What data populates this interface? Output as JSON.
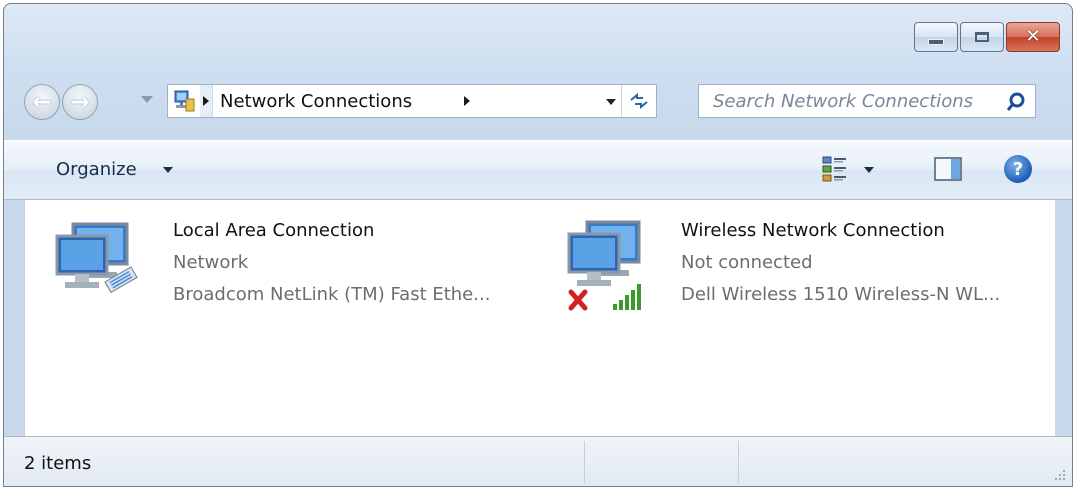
{
  "nav": {
    "address_path": "Network Connections",
    "search_placeholder": "Search Network Connections"
  },
  "toolbar": {
    "organize_label": "Organize"
  },
  "items": [
    {
      "name": "Local Area Connection",
      "status": "Network",
      "device": "Broadcom NetLink (TM) Fast Ethe...",
      "icon": "wired-network-icon"
    },
    {
      "name": "Wireless Network Connection",
      "status": "Not connected",
      "device": "Dell Wireless 1510 Wireless-N WL...",
      "icon": "wireless-network-icon"
    }
  ],
  "statusbar": {
    "count": "2 items"
  },
  "colors": {
    "frame": "#c8d9ec",
    "close_button": "#c4432a",
    "secondary_text": "#6d6d6d",
    "signal_green": "#3a9a2a",
    "error_red": "#d42020"
  }
}
